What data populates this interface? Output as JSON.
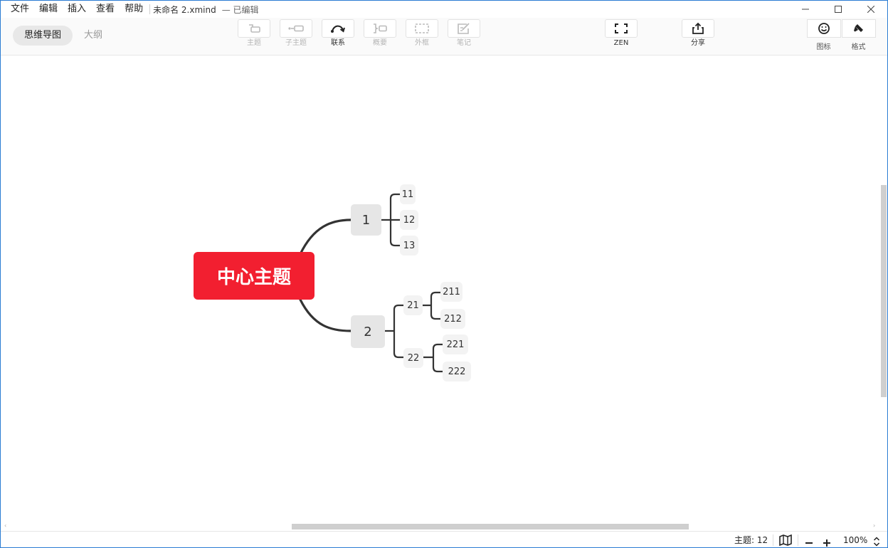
{
  "menu": [
    "文件",
    "编辑",
    "插入",
    "查看",
    "帮助"
  ],
  "document": {
    "title": "未命名 2.xmind",
    "status": "— 已编辑"
  },
  "view_tabs": {
    "mindmap": "思维导图",
    "outline": "大纲"
  },
  "tools": {
    "topic": "主题",
    "subtopic": "子主题",
    "relationship": "联系",
    "summary": "概要",
    "boundary": "外框",
    "note": "笔记",
    "zen": "ZEN",
    "share": "分享",
    "icon": "图标",
    "format": "格式"
  },
  "map": {
    "central": "中心主题",
    "branch1": {
      "label": "1",
      "children": [
        "11",
        "12",
        "13"
      ]
    },
    "branch2": {
      "label": "2",
      "sub21": {
        "label": "21",
        "children": [
          "211",
          "212"
        ]
      },
      "sub22": {
        "label": "22",
        "children": [
          "221",
          "222"
        ]
      }
    }
  },
  "status": {
    "topics": "主题: 12",
    "zoom": "100%"
  },
  "colors": {
    "central": "#f21f30",
    "accent": "#2b7cd3"
  }
}
